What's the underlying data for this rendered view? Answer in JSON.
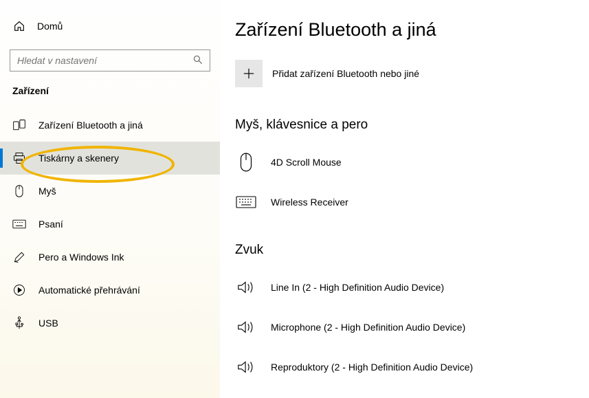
{
  "sidebar": {
    "home_label": "Domů",
    "search_placeholder": "Hledat v nastavení",
    "section_title": "Zařízení",
    "items": [
      {
        "label": "Zařízení Bluetooth a jiná",
        "icon": "bluetooth-devices-icon",
        "selected": false
      },
      {
        "label": "Tiskárny a skenery",
        "icon": "printer-icon",
        "selected": true
      },
      {
        "label": "Myš",
        "icon": "mouse-icon",
        "selected": false
      },
      {
        "label": "Psaní",
        "icon": "keyboard-icon",
        "selected": false
      },
      {
        "label": "Pero a Windows Ink",
        "icon": "pen-icon",
        "selected": false
      },
      {
        "label": "Automatické přehrávání",
        "icon": "autoplay-icon",
        "selected": false
      },
      {
        "label": "USB",
        "icon": "usb-icon",
        "selected": false
      }
    ]
  },
  "main": {
    "title": "Zařízení Bluetooth a jiná",
    "add_label": "Přidat zařízení Bluetooth nebo jiné",
    "sections": [
      {
        "heading": "Myš, klávesnice a pero",
        "devices": [
          {
            "name": "4D Scroll Mouse",
            "icon": "mouse"
          },
          {
            "name": "Wireless Receiver",
            "icon": "keyboard"
          }
        ]
      },
      {
        "heading": "Zvuk",
        "devices": [
          {
            "name": "Line In (2 - High Definition Audio Device)",
            "icon": "speaker"
          },
          {
            "name": "Microphone (2 - High Definition Audio Device)",
            "icon": "speaker"
          },
          {
            "name": "Reproduktory (2 - High Definition Audio Device)",
            "icon": "speaker"
          }
        ]
      }
    ]
  },
  "annotation": {
    "highlight_item_index": 1
  },
  "colors": {
    "accent": "#0078d4",
    "selected_bg": "#e2e2dc",
    "highlight": "#f0b400"
  }
}
